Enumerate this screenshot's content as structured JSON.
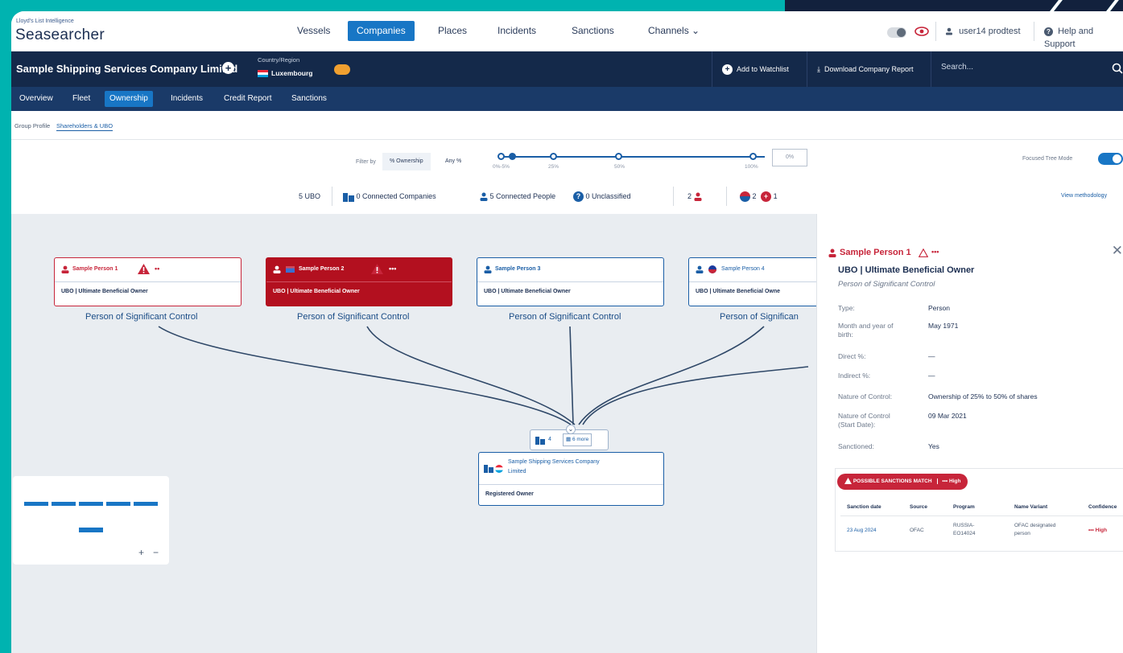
{
  "brand": {
    "small": "Lloyd's List Intelligence",
    "name": "Seasearcher"
  },
  "nav": [
    "Vessels",
    "Companies",
    "Places",
    "Incidents",
    "Sanctions",
    "Channels"
  ],
  "user": "user14 prodtest",
  "help": "Help and Support",
  "company": {
    "name": "Sample Shipping Services Company Limited",
    "country_label": "Country/Region",
    "country": "Luxembourg",
    "add_watchlist": "Add to Watchlist",
    "download_report": "Download Company Report",
    "search_placeholder": "Search..."
  },
  "tabs": [
    "Overview",
    "Fleet",
    "Ownership",
    "Incidents",
    "Credit Report",
    "Sanctions"
  ],
  "subtabs": [
    "Group Profile",
    "Shareholders & UBO"
  ],
  "filter": {
    "label": "Filter by",
    "options": [
      "% Ownership",
      "Any %"
    ],
    "ticks": [
      "0%-5%",
      "25%",
      "50%",
      "100%"
    ],
    "input_value": "0%",
    "focused_mode": "Focused Tree Mode"
  },
  "stats": {
    "ubo": "5 UBO",
    "connected_companies": "0 Connected Companies",
    "connected_people": "5 Connected People",
    "unclassified": "0 Unclassified",
    "sanctioned_people": "2",
    "flag_count": "2",
    "sanction_count": "1",
    "view_methodology": "View methodology"
  },
  "nodes": [
    {
      "name": "Sample Person 1",
      "role": "UBO | Ultimate Beneficial Owner",
      "control": "Person of Significant Control",
      "risk": "••"
    },
    {
      "name": "Sample Person 2",
      "role": "UBO | Ultimate Beneficial Owner",
      "control": "Person of Significant Control",
      "risk": "•••"
    },
    {
      "name": "Sample Person 3",
      "role": "UBO | Ultimate Beneficial Owner",
      "control": "Person of Significant Control",
      "risk": ""
    },
    {
      "name": "Sample Person 4",
      "role": "UBO | Ultimate Beneficial Owne",
      "control": "Person of Significan",
      "risk": ""
    }
  ],
  "center_node": {
    "count": "4",
    "count_label": "6 more",
    "name_line1": "Sample Shipping Services Company",
    "name_line2": "Limited",
    "role": "Registered Owner"
  },
  "minimap": {
    "zoom_in": "+",
    "zoom_out": "−"
  },
  "panel": {
    "name": "Sample Person 1",
    "risk": "•••",
    "title": "UBO | Ultimate Beneficial Owner",
    "subtitle": "Person of Significant Control",
    "fields": [
      {
        "label": "Type:",
        "value": "Person"
      },
      {
        "label": "Month and year of birth:",
        "value": "May 1971"
      },
      {
        "label": "Direct %:",
        "value": "—"
      },
      {
        "label": "Indirect %:",
        "value": "—"
      },
      {
        "label": "Nature of Control:",
        "value": "Ownership of 25% to 50% of shares"
      },
      {
        "label": "Nature of Control (Start Date):",
        "value": "09 Mar 2021"
      },
      {
        "label": "Sanctioned:",
        "value": "Yes"
      }
    ],
    "sanctions": {
      "badge": "POSSIBLE SANCTIONS MATCH",
      "badge_level": "••• High",
      "headers": [
        "Sanction date",
        "Source",
        "Program",
        "Name Variant",
        "Confidence"
      ],
      "row": {
        "date": "23 Aug 2024",
        "source": "OFAC",
        "program": "RUSSIA-EO14024",
        "variant": "OFAC designated person",
        "confidence": "••• High"
      }
    }
  },
  "colors": {
    "teal_bg": "#00b3b0",
    "navy": "#14294a",
    "accent": "#1876c5",
    "danger": "#c7253a"
  }
}
